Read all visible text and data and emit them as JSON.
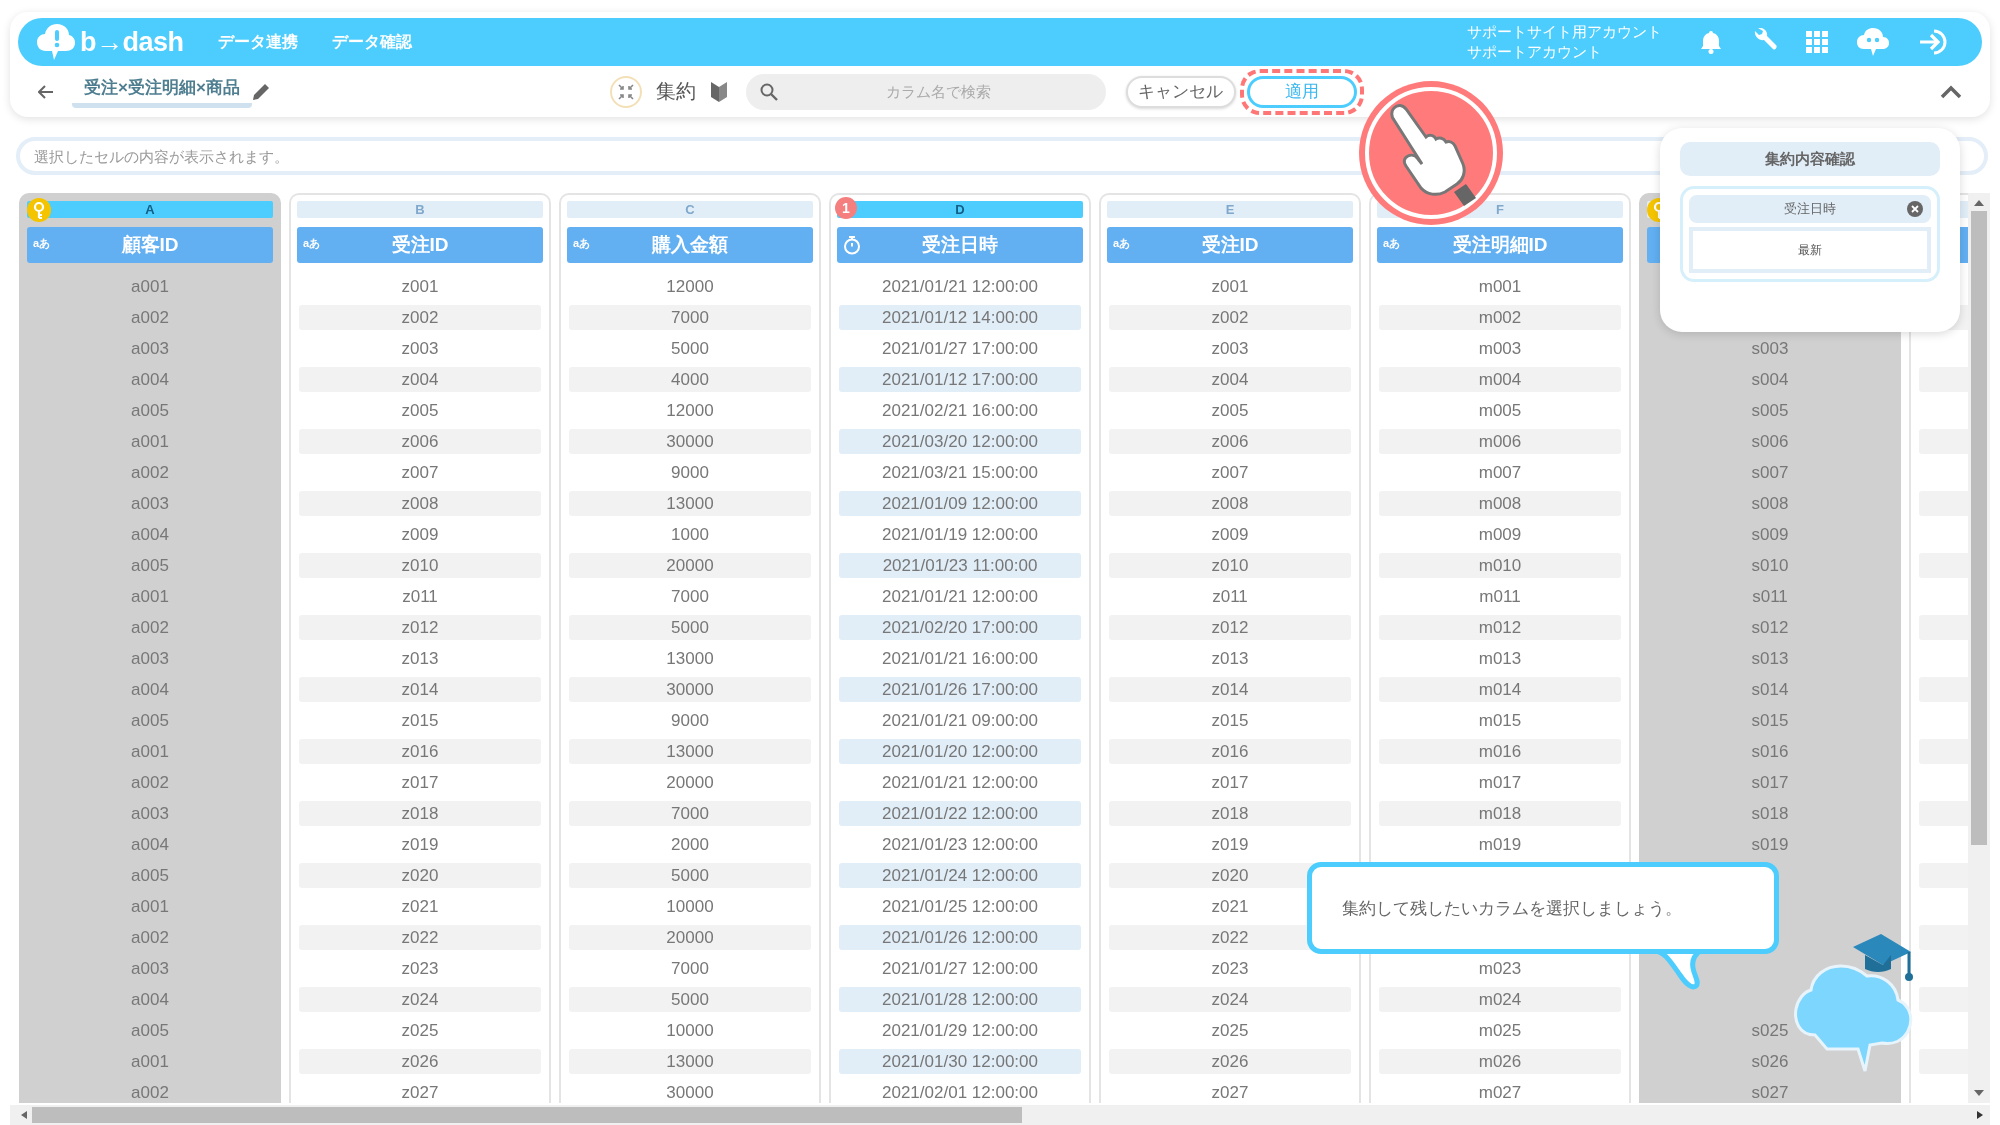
{
  "header": {
    "logo_text": "b→dash",
    "nav": [
      {
        "label": "データ連携"
      },
      {
        "label": "データ確認"
      }
    ],
    "account": [
      "サポートサイト用アカウント",
      "サポートアカウント"
    ]
  },
  "toolbar": {
    "title": "受注×受注明細×商品",
    "mode_label": "集約",
    "search": {
      "placeholder": "カラム名で検索"
    },
    "buttons": [
      {
        "label": "キャンセル",
        "kind": "secondary",
        "highlighted": false
      },
      {
        "label": "適用",
        "kind": "primary",
        "highlighted": true
      }
    ]
  },
  "cell_viewer": {
    "placeholder": "選択したセルの内容が表示されます。"
  },
  "columns": [
    {
      "letter": "A",
      "name": "顧客ID",
      "kind": "text",
      "type_label": "aあ",
      "key": true,
      "selected": true,
      "rows": [
        "a001",
        "a002",
        "a003",
        "a004",
        "a005",
        "a001",
        "a002",
        "a003",
        "a004",
        "a005",
        "a001",
        "a002",
        "a003",
        "a004",
        "a005",
        "a001",
        "a002",
        "a003",
        "a004",
        "a005",
        "a001",
        "a002",
        "a003",
        "a004",
        "a005",
        "a001",
        "a002"
      ]
    },
    {
      "letter": "B",
      "name": "受注ID",
      "kind": "text",
      "type_label": "aあ",
      "key": false,
      "selected": false,
      "rows": [
        "z001",
        "z002",
        "z003",
        "z004",
        "z005",
        "z006",
        "z007",
        "z008",
        "z009",
        "z010",
        "z011",
        "z012",
        "z013",
        "z014",
        "z015",
        "z016",
        "z017",
        "z018",
        "z019",
        "z020",
        "z021",
        "z022",
        "z023",
        "z024",
        "z025",
        "z026",
        "z027"
      ]
    },
    {
      "letter": "C",
      "name": "購入金額",
      "kind": "text",
      "type_label": "aあ",
      "key": false,
      "selected": false,
      "rows": [
        "12000",
        "7000",
        "5000",
        "4000",
        "12000",
        "30000",
        "9000",
        "13000",
        "1000",
        "20000",
        "7000",
        "5000",
        "13000",
        "30000",
        "9000",
        "13000",
        "20000",
        "7000",
        "2000",
        "5000",
        "10000",
        "20000",
        "7000",
        "5000",
        "10000",
        "13000",
        "30000"
      ]
    },
    {
      "letter": "D",
      "name": "受注日時",
      "kind": "datetime",
      "key": false,
      "selected": true,
      "badge": "1",
      "rows": [
        "2021/01/21 12:00:00",
        "2021/01/12 14:00:00",
        "2021/01/27 17:00:00",
        "2021/01/12 17:00:00",
        "2021/02/21 16:00:00",
        "2021/03/20 12:00:00",
        "2021/03/21 15:00:00",
        "2021/01/09 12:00:00",
        "2021/01/19 12:00:00",
        "2021/01/23 11:00:00",
        "2021/01/21 12:00:00",
        "2021/02/20 17:00:00",
        "2021/01/21 16:00:00",
        "2021/01/26 17:00:00",
        "2021/01/21 09:00:00",
        "2021/01/20 12:00:00",
        "2021/01/21 12:00:00",
        "2021/01/22 12:00:00",
        "2021/01/23 12:00:00",
        "2021/01/24 12:00:00",
        "2021/01/25 12:00:00",
        "2021/01/26 12:00:00",
        "2021/01/27 12:00:00",
        "2021/01/28 12:00:00",
        "2021/01/29 12:00:00",
        "2021/01/30 12:00:00",
        "2021/02/01 12:00:00"
      ]
    },
    {
      "letter": "E",
      "name": "受注ID",
      "kind": "text",
      "type_label": "aあ",
      "key": false,
      "selected": false,
      "rows": [
        "z001",
        "z002",
        "z003",
        "z004",
        "z005",
        "z006",
        "z007",
        "z008",
        "z009",
        "z010",
        "z011",
        "z012",
        "z013",
        "z014",
        "z015",
        "z016",
        "z017",
        "z018",
        "z019",
        "z020",
        "z021",
        "z022",
        "z023",
        "z024",
        "z025",
        "z026",
        "z027"
      ]
    },
    {
      "letter": "F",
      "name": "受注明細ID",
      "kind": "text",
      "type_label": "aあ",
      "key": false,
      "selected": false,
      "rows": [
        "m001",
        "m002",
        "m003",
        "m004",
        "m005",
        "m006",
        "m007",
        "m008",
        "m009",
        "m010",
        "m011",
        "m012",
        "m013",
        "m014",
        "m015",
        "m016",
        "m017",
        "m018",
        "m019",
        null,
        null,
        null,
        "m023",
        "m024",
        "m025",
        "m026",
        "m027"
      ]
    },
    {
      "kind": "text",
      "key": true,
      "rows": [
        null,
        null,
        "s003",
        "s004",
        "s005",
        "s006",
        "s007",
        "s008",
        "s009",
        "s010",
        "s011",
        "s012",
        "s013",
        "s014",
        "s015",
        "s016",
        "s017",
        "s018",
        "s019",
        null,
        null,
        null,
        null,
        null,
        "s025",
        "s026",
        "s027"
      ]
    },
    {
      "kind": "text",
      "key": false,
      "rows": [
        null,
        null,
        null,
        null,
        null,
        null,
        null,
        null,
        null,
        null,
        null,
        null,
        null,
        null,
        null,
        null,
        null,
        null,
        null,
        null,
        null,
        null,
        null,
        null,
        null,
        null,
        null
      ]
    }
  ],
  "summary_popup": {
    "title": "集約内容確認",
    "items": [
      {
        "column": "受注日時",
        "method": "最新"
      }
    ]
  },
  "tooltip": {
    "text": "集約して残したいカラムを選択しましょう。"
  }
}
